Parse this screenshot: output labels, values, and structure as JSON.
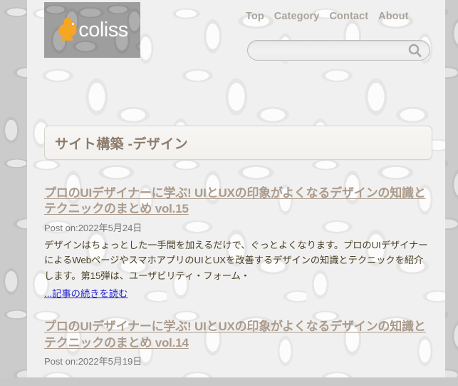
{
  "site": {
    "logo_text": "coliss",
    "logo_icon": "squirrel-icon"
  },
  "nav": {
    "items": [
      {
        "label": "Top"
      },
      {
        "label": "Category"
      },
      {
        "label": "Contact"
      },
      {
        "label": "About"
      }
    ]
  },
  "search": {
    "value": "",
    "placeholder": "",
    "icon": "search-icon"
  },
  "main": {
    "page_title": "サイト構築 -デザイン",
    "posts": [
      {
        "title": "プロのUIデザイナーに学ぶ! UIとUXの印象がよくなるデザインの知識とテクニックのまとめ vol.15",
        "date": "Post on:2022年5月24日",
        "excerpt": "デザインはちょっとした一手間を加えるだけで、ぐっとよくなります。プロのUIデザイナーによるWebページやスマホアプリのUIとUXを改善するデザインの知識とテクニックを紹介します。第15弾は、ユーザビリティ・フォーム・",
        "read_more": "...記事の続きを読む"
      },
      {
        "title": "プロのUIデザイナーに学ぶ! UIとUXの印象がよくなるデザインの知識とテクニックのまとめ vol.14",
        "date": "Post on:2022年5月19日",
        "excerpt": "",
        "read_more": ""
      }
    ]
  },
  "colors": {
    "logo_accent": "#f5a623",
    "title_text": "#8d7c6d",
    "post_title": "#ab9a8b",
    "body_text": "#4b4026",
    "link": "#2222cc",
    "nav_text": "#aaa49b"
  }
}
